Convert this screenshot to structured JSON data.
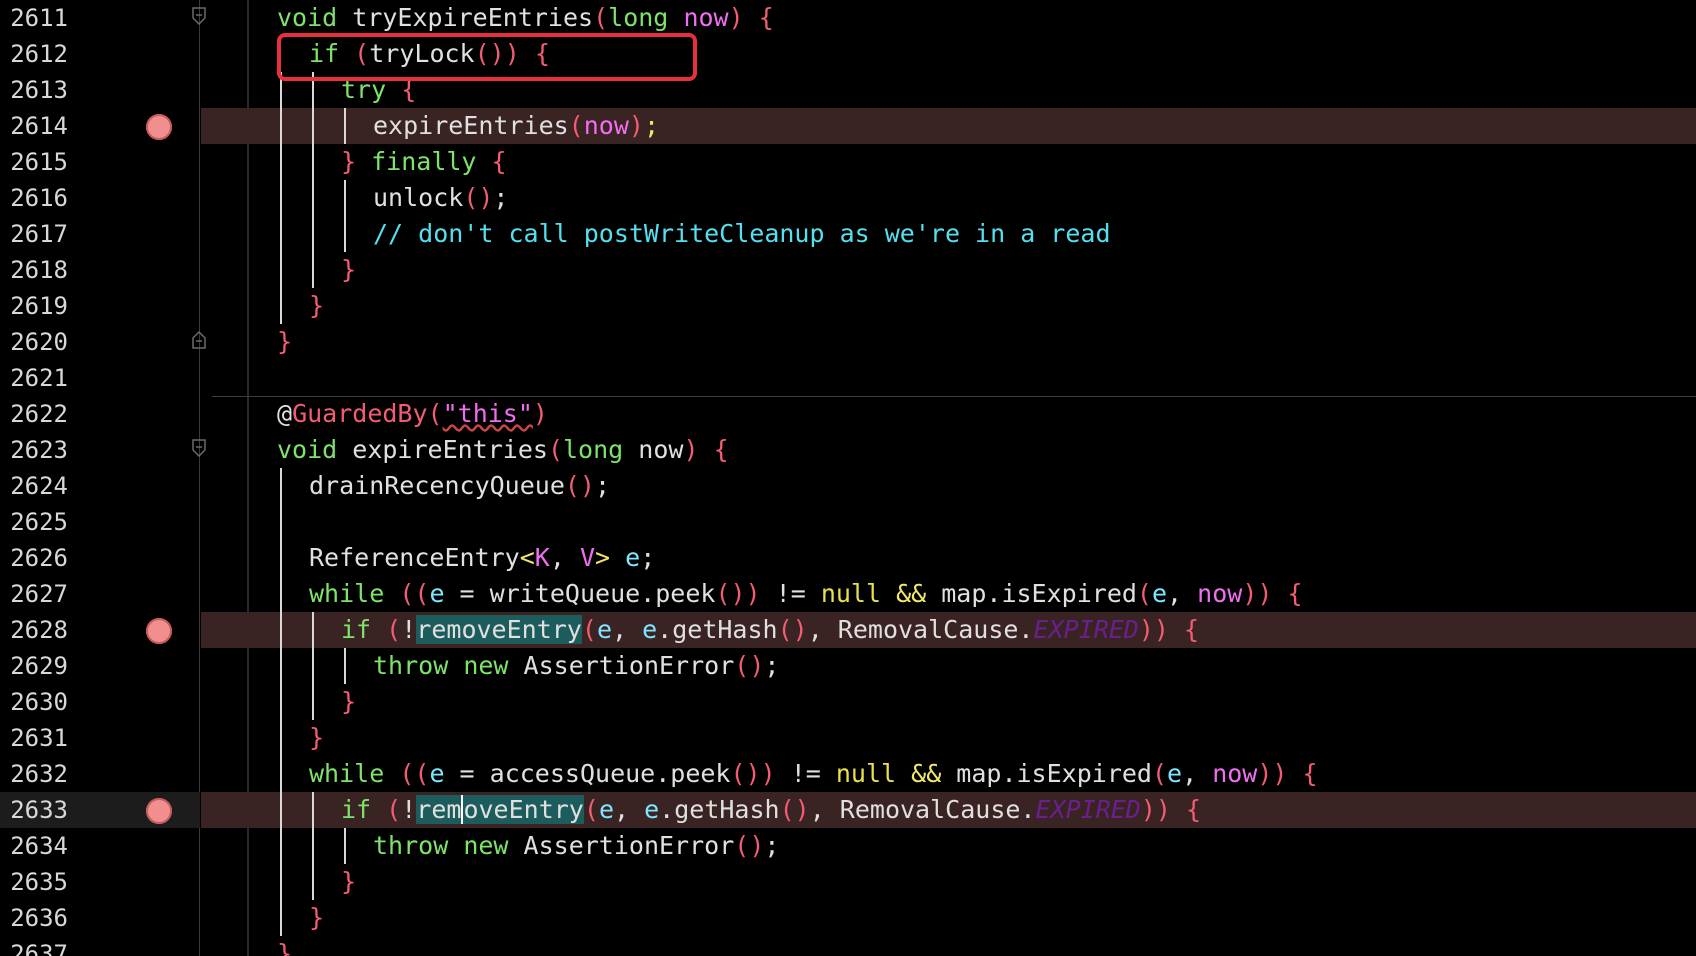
{
  "editor": {
    "language": "java",
    "callout_color": "#e8303a",
    "breakpoint_color": "#f28e8e",
    "hint_icon": "lightbulb-icon"
  },
  "lines": [
    {
      "n": "2611",
      "text": "void tryExpireEntries(long now) {"
    },
    {
      "n": "2612",
      "text": "if (tryLock()) {"
    },
    {
      "n": "2613",
      "text": "try {"
    },
    {
      "n": "2614",
      "text": "expireEntries(now);"
    },
    {
      "n": "2615",
      "text": "} finally {"
    },
    {
      "n": "2616",
      "text": "unlock();"
    },
    {
      "n": "2617",
      "text": "// don't call postWriteCleanup as we're in a read"
    },
    {
      "n": "2618",
      "text": "}"
    },
    {
      "n": "2619",
      "text": "}"
    },
    {
      "n": "2620",
      "text": "}"
    },
    {
      "n": "2621",
      "text": ""
    },
    {
      "n": "2622",
      "text": "@GuardedBy(\"this\")"
    },
    {
      "n": "2623",
      "text": "void expireEntries(long now) {"
    },
    {
      "n": "2624",
      "text": "drainRecencyQueue();"
    },
    {
      "n": "2625",
      "text": ""
    },
    {
      "n": "2626",
      "text": "ReferenceEntry<K, V> e;"
    },
    {
      "n": "2627",
      "text": "while ((e = writeQueue.peek()) != null && map.isExpired(e, now)) {"
    },
    {
      "n": "2628",
      "text": "if (!removeEntry(e, e.getHash(), RemovalCause.EXPIRED)) {"
    },
    {
      "n": "2629",
      "text": "throw new AssertionError();"
    },
    {
      "n": "2630",
      "text": "}"
    },
    {
      "n": "2631",
      "text": "}"
    },
    {
      "n": "2632",
      "text": "while ((e = accessQueue.peek()) != null && map.isExpired(e, now)) {"
    },
    {
      "n": "2633",
      "text": "if (!removeEntry(e, e.getHash(), RemovalCause.EXPIRED)) {"
    },
    {
      "n": "2634",
      "text": "throw new AssertionError();"
    },
    {
      "n": "2635",
      "text": "}"
    },
    {
      "n": "2636",
      "text": "}"
    },
    {
      "n": "2637",
      "text": "}"
    }
  ],
  "breakpoint_lines": [
    "2614",
    "2628",
    "2633"
  ],
  "current_line": "2633"
}
